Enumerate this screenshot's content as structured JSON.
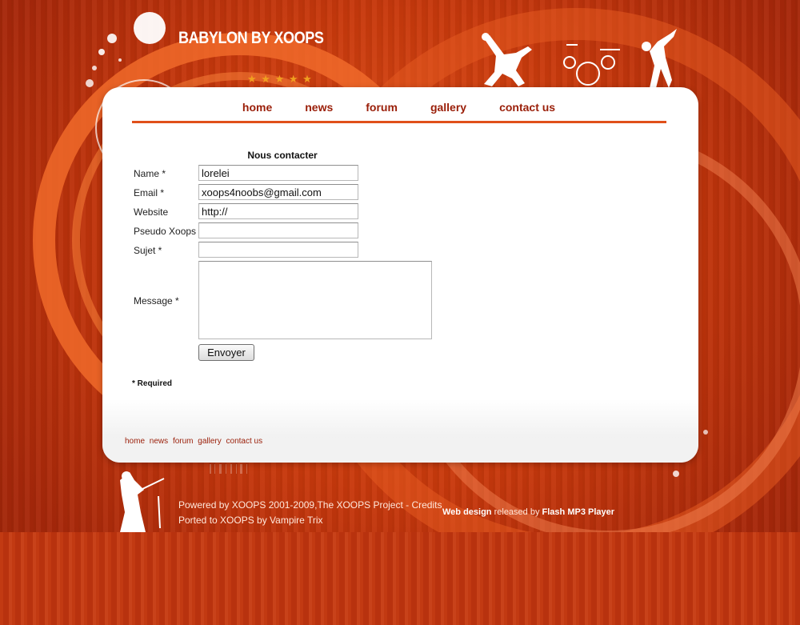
{
  "header": {
    "title": "BABYLON BY XOOPS",
    "stars": [
      "★",
      "★",
      "★",
      "★",
      "★"
    ]
  },
  "nav": {
    "items": [
      {
        "label": "home"
      },
      {
        "label": "news"
      },
      {
        "label": "forum"
      },
      {
        "label": "gallery"
      },
      {
        "label": "contact us"
      }
    ]
  },
  "form": {
    "title": "Nous contacter",
    "name_label": "Name *",
    "name_value": "lorelei",
    "email_label": "Email *",
    "email_value": "xoops4noobs@gmail.com",
    "website_label": "Website",
    "website_value": "http://",
    "pseudo_label": "Pseudo Xoops",
    "pseudo_value": "",
    "subject_label": "Sujet *",
    "subject_value": "",
    "message_label": "Message *",
    "message_value": "",
    "submit_label": "Envoyer",
    "required_note": "* Required"
  },
  "footer": {
    "links": [
      "home",
      "news",
      "forum",
      "gallery",
      "contact us"
    ],
    "powered_line": "Powered by XOOPS 2001-2009,The XOOPS Project - Credits",
    "ported_line": "Ported to XOOPS by Vampire Trix",
    "design_link": "Web design",
    "design_middle": "released by",
    "player_link": "Flash MP3 Player"
  },
  "colors": {
    "accent": "#e0501a",
    "nav_text": "#9a1e08",
    "background": "#c8390c"
  }
}
